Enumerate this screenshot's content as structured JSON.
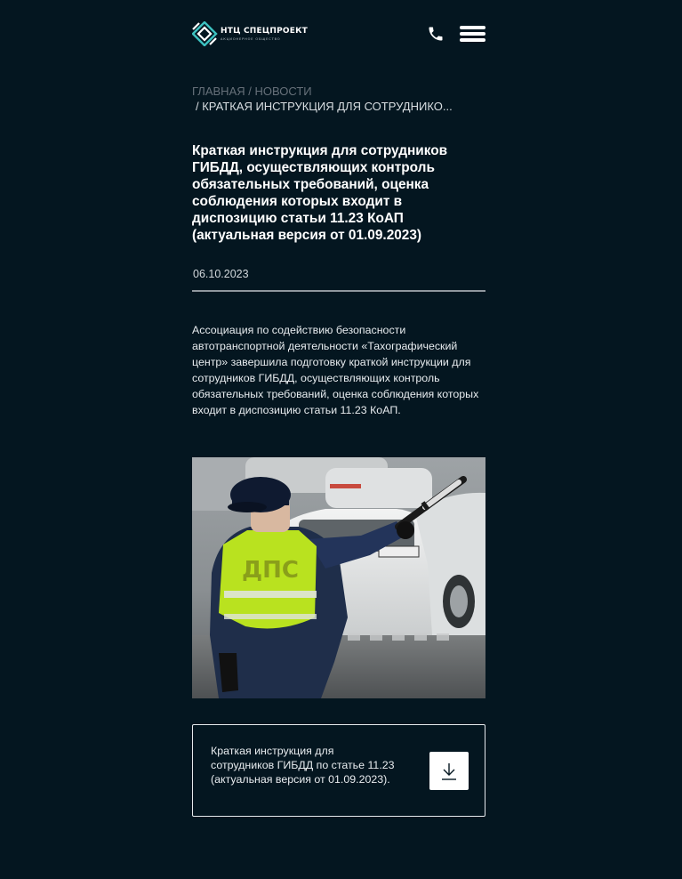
{
  "header": {
    "logo_name": "НТЦ СПЕЦПРОЕКТ",
    "logo_sub": "АКЦИОНЕРНОЕ ОБЩЕСТВО",
    "phone_icon": "phone-icon",
    "menu_icon": "hamburger-menu-icon"
  },
  "breadcrumb": {
    "home": "ГЛАВНАЯ",
    "separator": "/",
    "news": "НОВОСТИ",
    "current": "/ КРАТКАЯ ИНСТРУКЦИЯ ДЛЯ СОТРУДНИКО..."
  },
  "article": {
    "title": "Краткая инструкция для сотрудников ГИБДД, осуществляющих контроль обязательных требований, оценка соблюдения которых входит в диспозицию статьи 11.23 КоАП (актуальная версия от 01.09.2023)",
    "date": "06.10.2023",
    "lead": "Ассоциация по содействию безопасности автотранспортной деятельности «Тахографический центр» завершила подготовку краткой инструкции для сотрудников ГИБДД, осуществляющих контроль обязательных требований, оценка соблюдения которых входит в диспозицию статьи 11.23 КоАП.",
    "image_vest_text": "ДПС"
  },
  "document": {
    "label": "Краткая инструкция для сотрудников ГИБДД по статье 11.23 (актуальная версия от 01.09.2023).",
    "icon": "download-icon"
  },
  "colors": {
    "background": "#041620",
    "text": "#ffffff",
    "muted": "#67717a",
    "accent": "#3dc1c0"
  }
}
